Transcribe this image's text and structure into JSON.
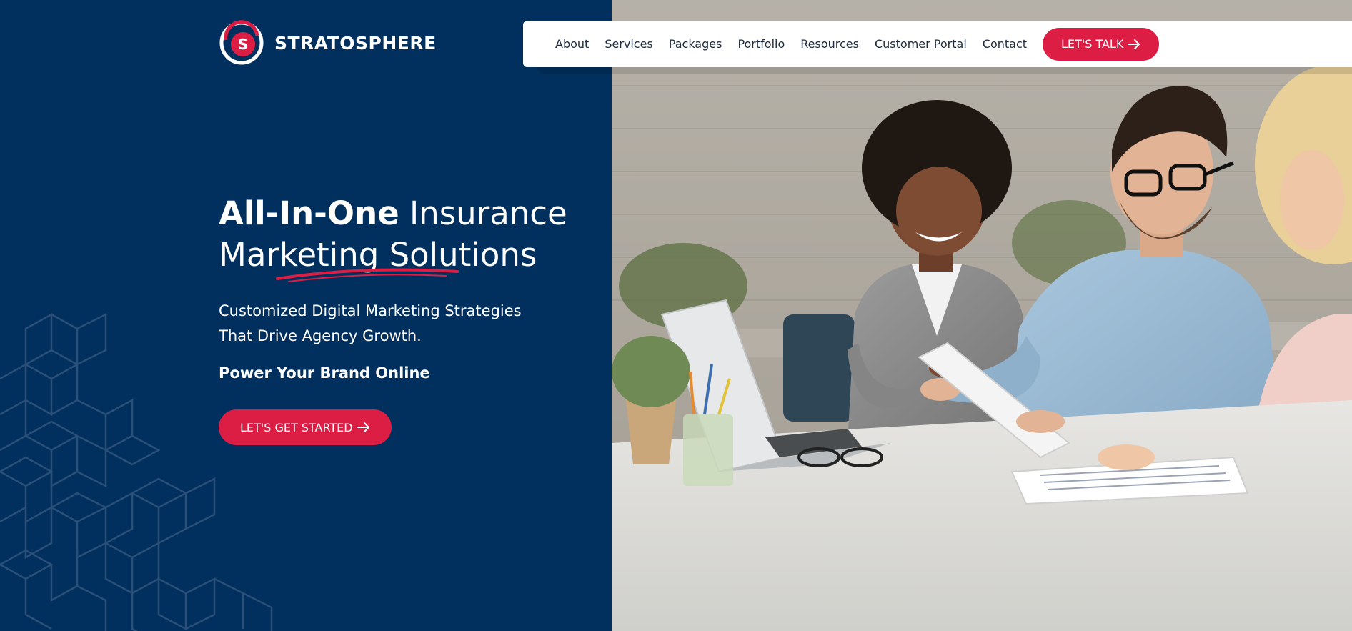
{
  "brand": {
    "name": "STRATOSPHERE",
    "logo_letter": "S"
  },
  "nav": {
    "items": [
      {
        "label": "About"
      },
      {
        "label": "Services"
      },
      {
        "label": "Packages"
      },
      {
        "label": "Portfolio"
      },
      {
        "label": "Resources"
      },
      {
        "label": "Customer Portal"
      },
      {
        "label": "Contact"
      }
    ],
    "cta_label": "LET'S TALK",
    "cta_icon": "arrow-right-icon"
  },
  "hero": {
    "title_bold": "All-In-One",
    "title_rest": "Insurance",
    "title_line2": "Marketing Solutions",
    "subtitle": "Customized Digital Marketing Strategies That Drive Agency Growth.",
    "tagline": "Power Your Brand Online",
    "cta_label": "LET'S GET STARTED",
    "cta_icon": "arrow-right-icon"
  },
  "colors": {
    "navy": "#02305e",
    "accent_red": "#dc1e45",
    "white": "#ffffff",
    "nav_text": "#1c2a3d"
  }
}
